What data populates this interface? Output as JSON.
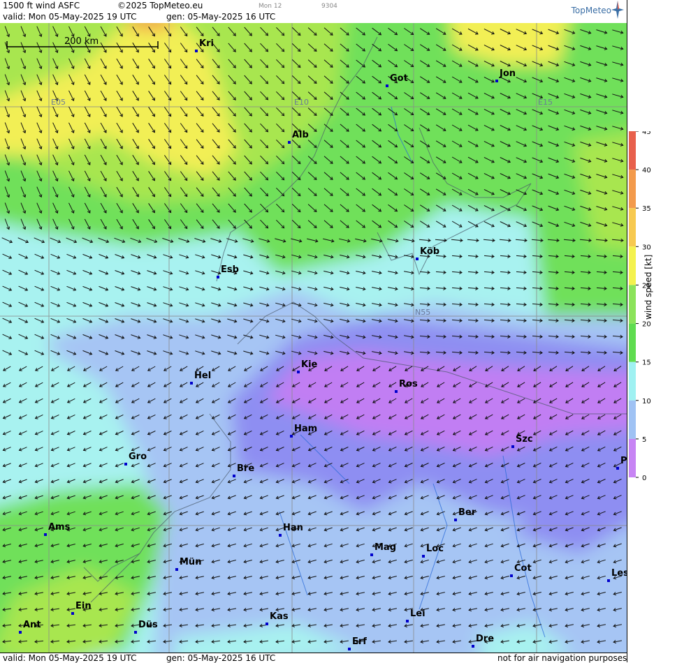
{
  "header": {
    "product": "1500 ft wind ASFC",
    "copyright": "©2025 TopMeteo.eu",
    "valid": "valid:  Mon  05-May-2025  19 UTC",
    "gen": "gen: 05-May-2025 16 UTC",
    "small_a": "Mon 12",
    "small_b": "9304",
    "brand": "TopMeteo"
  },
  "footer": {
    "valid": "valid:  Mon  05-May-2025  19 UTC",
    "gen": "gen: 05-May-2025 16 UTC",
    "disclaimer": "not for air navigation purposes"
  },
  "scale": {
    "label": "200 km"
  },
  "grid_labels": [
    {
      "id": "e05",
      "text": "E05"
    },
    {
      "id": "e10",
      "text": "E10"
    },
    {
      "id": "e15",
      "text": "E15"
    },
    {
      "id": "n55",
      "text": "N55"
    }
  ],
  "cities": [
    {
      "name": "Kri"
    },
    {
      "name": "Got"
    },
    {
      "name": "Jon"
    },
    {
      "name": "Alb"
    },
    {
      "name": "Esb"
    },
    {
      "name": "Köb"
    },
    {
      "name": "Kie"
    },
    {
      "name": "Ros"
    },
    {
      "name": "Hel"
    },
    {
      "name": "Ham"
    },
    {
      "name": "Szc"
    },
    {
      "name": "Gro"
    },
    {
      "name": "Bre"
    },
    {
      "name": "P"
    },
    {
      "name": "Ber"
    },
    {
      "name": "Ams"
    },
    {
      "name": "Han"
    },
    {
      "name": "Mag"
    },
    {
      "name": "Loc"
    },
    {
      "name": "Mün"
    },
    {
      "name": "Cot"
    },
    {
      "name": "Les"
    },
    {
      "name": "Ein"
    },
    {
      "name": "Kas"
    },
    {
      "name": "Lei"
    },
    {
      "name": "Ant"
    },
    {
      "name": "Düs"
    },
    {
      "name": "Dre"
    },
    {
      "name": "Erf"
    }
  ],
  "legend": {
    "unit_label": "wind speed [kt]",
    "ticks": [
      "45",
      "40",
      "35",
      "30",
      "25",
      "20",
      "15",
      "10",
      "5",
      "0"
    ],
    "colors": [
      "#e8604c",
      "#f39a4b",
      "#f7c94f",
      "#f4f24e",
      "#c3ea4f",
      "#8be35a",
      "#5fdc50",
      "#9ff1f2",
      "#9fc2f4",
      "#8f8ff3",
      "#c784f4"
    ]
  }
}
